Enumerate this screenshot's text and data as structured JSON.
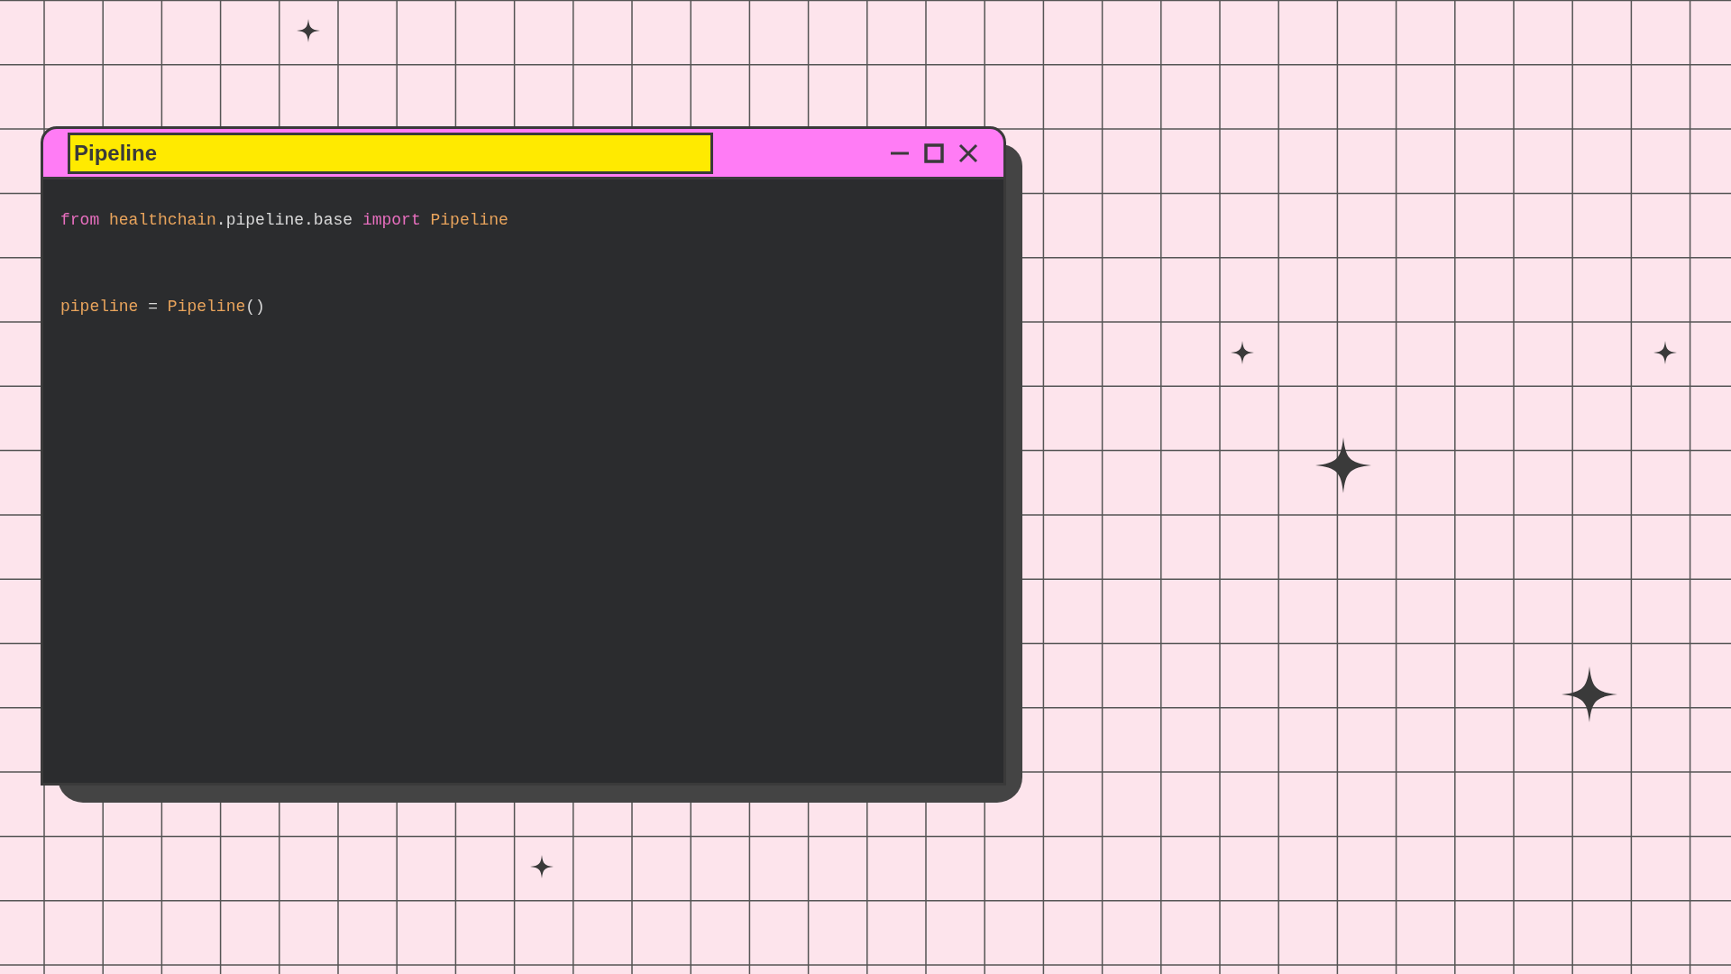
{
  "window": {
    "title": "Pipeline"
  },
  "code": [
    {
      "tokens": [
        {
          "text": "from",
          "kind": "keyword",
          "space_before": false
        },
        {
          "text": "healthchain",
          "kind": "name",
          "space_before": true
        },
        {
          "text": ".pipeline.base",
          "kind": "plain",
          "space_before": false
        },
        {
          "text": "import",
          "kind": "keyword",
          "space_before": true
        },
        {
          "text": "Pipeline",
          "kind": "name",
          "space_before": true
        }
      ]
    },
    {
      "tokens": [
        {
          "text": "pipeline",
          "kind": "name",
          "space_before": false
        },
        {
          "text": "=",
          "kind": "plain",
          "space_before": true
        },
        {
          "text": "Pipeline",
          "kind": "name",
          "space_before": true
        },
        {
          "text": "()",
          "kind": "plain",
          "space_before": false
        }
      ]
    }
  ]
}
